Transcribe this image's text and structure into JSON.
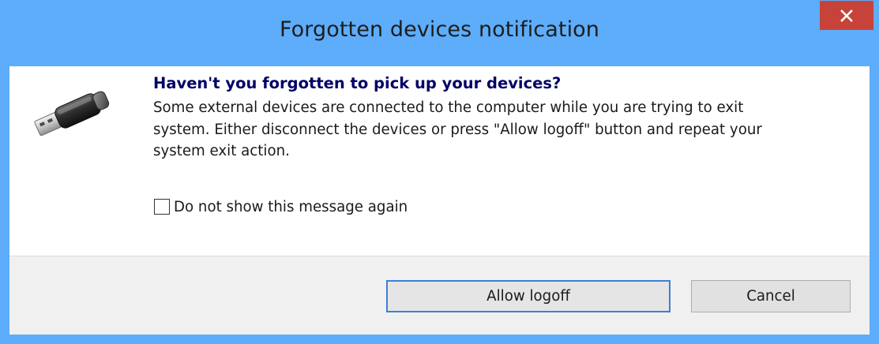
{
  "window": {
    "title": "Forgotten devices notification",
    "colors": {
      "frame": "#5dadfa",
      "close_button": "#c7433a",
      "heading": "#000066",
      "footer": "#f0f0f0",
      "default_button_border": "#3c7fd8"
    }
  },
  "titlebar": {
    "close_icon": "close-icon"
  },
  "content": {
    "icon": "usb-drive-icon",
    "heading": "Haven't you forgotten to pick up your devices?",
    "message_lines": [
      "Some external devices are connected to the computer while you are trying to exit",
      "system. Either disconnect the devices or press \"Allow logoff\" button and repeat your",
      "system exit action."
    ],
    "checkbox": {
      "label": "Do not show this message again",
      "checked": false
    }
  },
  "footer": {
    "allow_label": "Allow logoff",
    "cancel_label": "Cancel"
  }
}
